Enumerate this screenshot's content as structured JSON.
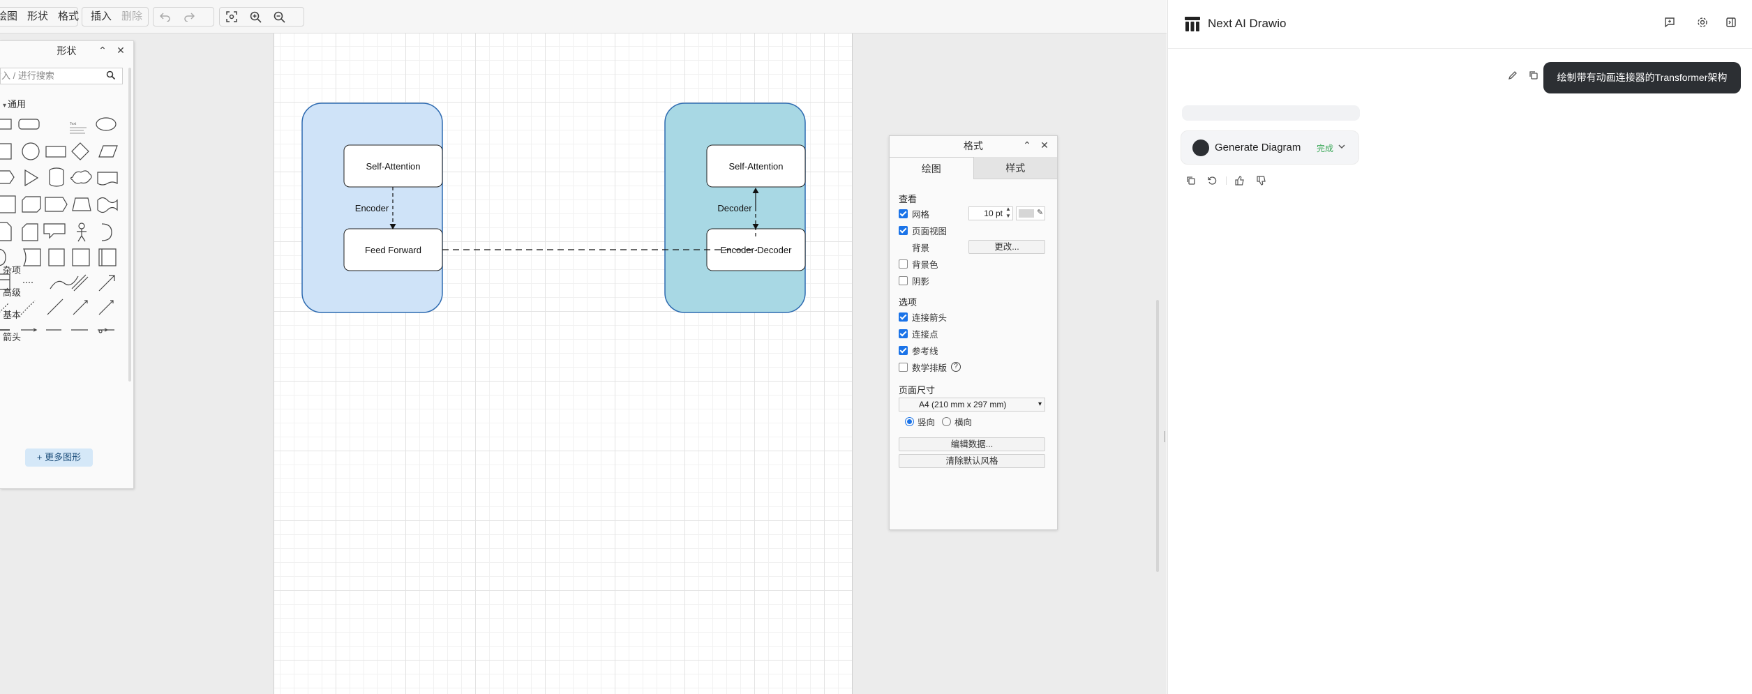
{
  "toolbar": {
    "menu": [
      "绘图",
      "形状",
      "格式"
    ],
    "insert_label": "插入",
    "delete_label": "删除"
  },
  "shapes_panel": {
    "title": "形状",
    "search_placeholder": "输入 / 进行搜索",
    "category_general": "通用",
    "categories": [
      "杂项",
      "高级",
      "基本",
      "箭头"
    ],
    "more_shapes_label": "+ 更多图形"
  },
  "diagram": {
    "encoder": {
      "label": "Encoder",
      "fill": "#cfe3f8",
      "blocks": [
        "Self-Attention",
        "Feed Forward"
      ]
    },
    "decoder": {
      "label": "Decoder",
      "fill": "#a8d8e4",
      "blocks": [
        "Self-Attention",
        "Encoder-Decoder"
      ]
    },
    "stroke": "#2d6ab0"
  },
  "format_panel": {
    "title": "格式",
    "tabs": [
      "绘图",
      "样式"
    ],
    "view_section": "查看",
    "grid_label": "网格",
    "grid_size": "10 pt",
    "page_view_label": "页面视图",
    "background_label": "背景",
    "change_button": "更改...",
    "bg_color_label": "背景色",
    "shadow_label": "阴影",
    "options_section": "选项",
    "connection_arrows_label": "连接箭头",
    "connection_points_label": "连接点",
    "guides_label": "参考线",
    "math_label": "数学排版",
    "page_size_section": "页面尺寸",
    "page_size_value": "A4 (210 mm x 297 mm)",
    "portrait_label": "竖向",
    "landscape_label": "横向",
    "edit_data_button": "编辑数据...",
    "clear_style_button": "清除默认风格"
  },
  "chat": {
    "app_title": "Next AI Drawio",
    "user_message": "绘制带有动画连接器的Transformer架构",
    "tool_name": "Generate Diagram",
    "tool_status": "完成",
    "status_color": "#3aa757"
  }
}
